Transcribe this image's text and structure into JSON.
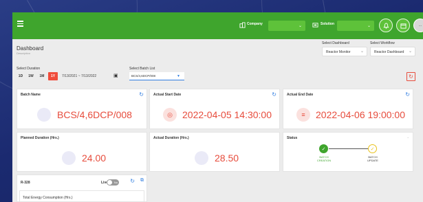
{
  "topbar": {
    "company_label": "Company",
    "company_value": "",
    "solution_label": "Solution",
    "solution_value": "",
    "avatar_text": "..."
  },
  "header": {
    "title": "Dashboard",
    "subtitle": "Description",
    "select_dashboard_label": "Select Dashboard",
    "select_dashboard_value": "Reactor Monitor",
    "select_workflow_label": "Select Workflow",
    "select_workflow_value": "Reactor Dashboard"
  },
  "filters": {
    "duration_label": "Select Duration",
    "durations": [
      "1D",
      "1W",
      "1M",
      "1Y"
    ],
    "active_duration": "1Y",
    "date_range": "7/13/2021 ~ 7/13/2022",
    "batch_list_label": "Select Batch List",
    "batch_list_value": "BCS/4,6DCP/008"
  },
  "cards": {
    "batch_name": {
      "title": "Batch Name",
      "value": "BCS/4,6DCP/008"
    },
    "actual_start": {
      "title": "Actual Start Date",
      "value": "2022-04-05 14:30:00"
    },
    "actual_end": {
      "title": "Actual End Date",
      "value": "2022-04-06 19:00:00"
    },
    "planned_duration": {
      "title": "Planned Duration (Hrs.)",
      "value": "24.00"
    },
    "actual_duration": {
      "title": "Actual Duration (Hrs.)",
      "value": "28.50"
    },
    "status": {
      "title": "Status",
      "collapse": "-",
      "step1": "BATCH\nCREATION",
      "step2": "BATCH\nUPDATE"
    }
  },
  "r328": {
    "title": "R-328",
    "live_label": "Live",
    "toggle_text": "No",
    "inner_title": "Total Energy Consumption (Hrs.)"
  },
  "colors": {
    "topbar": "#3fa52d",
    "accent_red": "#e74c3c",
    "accent_blue": "#2f7de1",
    "status_green": "#3fa52d",
    "status_yellow": "#e8c11a"
  }
}
